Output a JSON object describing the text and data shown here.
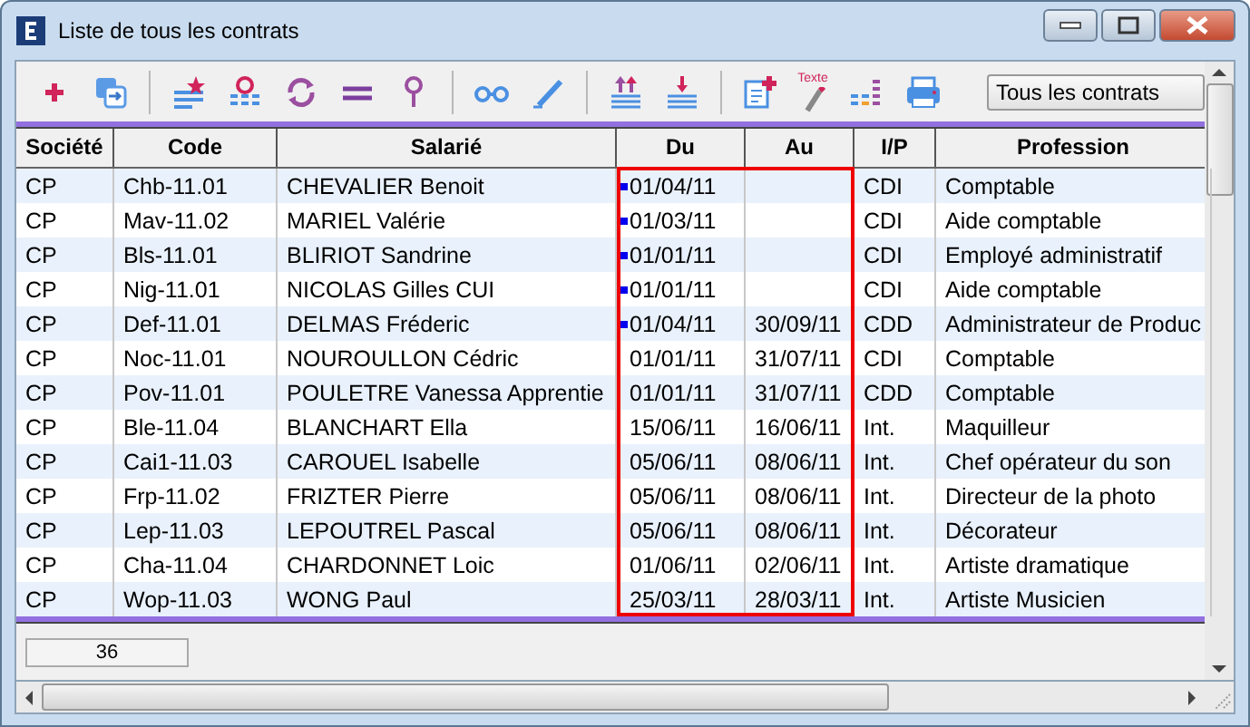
{
  "window": {
    "title": "Liste de tous les contrats"
  },
  "toolbar": [
    {
      "kind": "add"
    },
    {
      "kind": "copy"
    },
    {
      "kind": "separator"
    },
    {
      "kind": "list-star"
    },
    {
      "kind": "list-pin"
    },
    {
      "kind": "refresh"
    },
    {
      "kind": "equals"
    },
    {
      "kind": "pin"
    },
    {
      "kind": "separator"
    },
    {
      "kind": "glasses"
    },
    {
      "kind": "pen"
    },
    {
      "kind": "separator"
    },
    {
      "kind": "sort-up"
    },
    {
      "kind": "sort-down"
    },
    {
      "kind": "separator"
    },
    {
      "kind": "doc-add"
    },
    {
      "kind": "text-pen",
      "label": "Texte"
    },
    {
      "kind": "bars"
    },
    {
      "kind": "printer"
    }
  ],
  "filter": {
    "value": "Tous les contrats"
  },
  "table": {
    "columns": [
      {
        "label": "Société",
        "highlighted": false
      },
      {
        "label": "Code",
        "highlighted": false
      },
      {
        "label": "Salarié",
        "highlighted": false
      },
      {
        "label": "Du",
        "highlighted": true
      },
      {
        "label": "Au",
        "highlighted": true
      },
      {
        "label": "I/P",
        "highlighted": false
      },
      {
        "label": "Profession",
        "highlighted": false
      }
    ],
    "rows": [
      {
        "cells": [
          "CP",
          "Chb-11.01",
          "CHEVALIER Benoit",
          "01/04/11",
          "",
          "CDI",
          "Comptable"
        ],
        "marked": true
      },
      {
        "cells": [
          "CP",
          "Mav-11.02",
          "MARIEL Valérie",
          "01/03/11",
          "",
          "CDI",
          "Aide comptable"
        ],
        "marked": true
      },
      {
        "cells": [
          "CP",
          "Bls-11.01",
          "BLIRIOT Sandrine",
          "01/01/11",
          "",
          "CDI",
          "Employé administratif"
        ],
        "marked": true
      },
      {
        "cells": [
          "CP",
          "Nig-11.01",
          "NICOLAS Gilles CUI",
          "01/01/11",
          "",
          "CDI",
          "Aide comptable"
        ],
        "marked": true
      },
      {
        "cells": [
          "CP",
          "Def-11.01",
          "DELMAS Fréderic",
          "01/04/11",
          "30/09/11",
          "CDD",
          "Administrateur de Produc"
        ],
        "marked": true
      },
      {
        "cells": [
          "CP",
          "Noc-11.01",
          "NOUROULLON Cédric",
          "01/01/11",
          "31/07/11",
          "CDI",
          "Comptable"
        ],
        "marked": false
      },
      {
        "cells": [
          "CP",
          "Pov-11.01",
          "POULETRE Vanessa Apprentie",
          "01/01/11",
          "31/07/11",
          "CDD",
          "Comptable"
        ],
        "marked": false
      },
      {
        "cells": [
          "CP",
          "Ble-11.04",
          "BLANCHART Ella",
          "15/06/11",
          "16/06/11",
          "Int.",
          "Maquilleur"
        ],
        "marked": false
      },
      {
        "cells": [
          "CP",
          "Cai1-11.03",
          "CAROUEL Isabelle",
          "05/06/11",
          "08/06/11",
          "Int.",
          "Chef opérateur du son"
        ],
        "marked": false
      },
      {
        "cells": [
          "CP",
          "Frp-11.02",
          "FRIZTER Pierre",
          "05/06/11",
          "08/06/11",
          "Int.",
          "Directeur de la photo"
        ],
        "marked": false
      },
      {
        "cells": [
          "CP",
          "Lep-11.03",
          "LEPOUTREL Pascal",
          "05/06/11",
          "08/06/11",
          "Int.",
          "Décorateur"
        ],
        "marked": false
      },
      {
        "cells": [
          "CP",
          "Cha-11.04",
          "CHARDONNET Loic",
          "01/06/11",
          "02/06/11",
          "Int.",
          "Artiste dramatique"
        ],
        "marked": false
      },
      {
        "cells": [
          "CP",
          "Wop-11.03",
          "WONG Paul",
          "25/03/11",
          "28/03/11",
          "Int.",
          "Artiste Musicien"
        ],
        "marked": false
      }
    ]
  },
  "footer": {
    "count": "36"
  }
}
